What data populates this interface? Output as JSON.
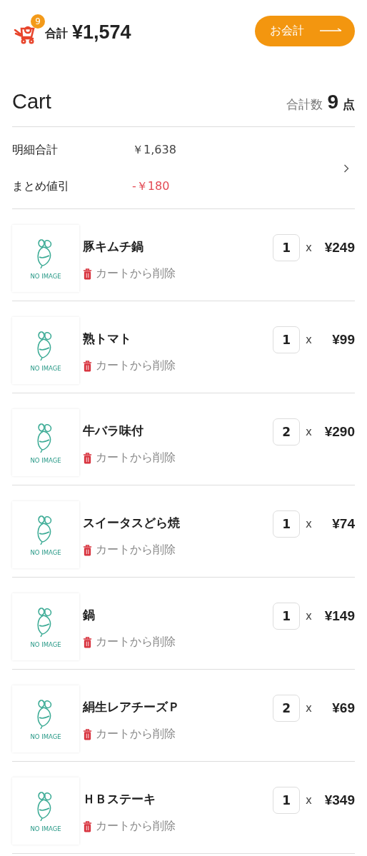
{
  "header": {
    "cart_count": "9",
    "total_label": "合計",
    "total": "¥1,574",
    "checkout_button": "お会計"
  },
  "cart": {
    "title": "Cart",
    "count_label": "合計数",
    "count": "9",
    "count_unit": "点"
  },
  "summary": [
    {
      "label": "明細合計",
      "value": "￥1,638",
      "kind": "normal"
    },
    {
      "label": "まとめ値引",
      "value": "-￥180",
      "kind": "discount"
    }
  ],
  "items": [
    {
      "name": "豚キムチ鍋",
      "image_label": "NO IMAGE",
      "remove": "カートから削除",
      "quantity": "1",
      "times": "x",
      "price": "¥249"
    },
    {
      "name": "熟トマト",
      "image_label": "NO IMAGE",
      "remove": "カートから削除",
      "quantity": "1",
      "times": "x",
      "price": "¥99"
    },
    {
      "name": "牛バラ味付",
      "image_label": "NO IMAGE",
      "remove": "カートから削除",
      "quantity": "2",
      "times": "x",
      "price": "¥290"
    },
    {
      "name": "スイータスどら焼",
      "image_label": "NO IMAGE",
      "remove": "カートから削除",
      "quantity": "1",
      "times": "x",
      "price": "¥74"
    },
    {
      "name": "鍋",
      "image_label": "NO IMAGE",
      "remove": "カートから削除",
      "quantity": "1",
      "times": "x",
      "price": "¥149"
    },
    {
      "name": "絹生レアチーズＰ",
      "image_label": "NO IMAGE",
      "remove": "カートから削除",
      "quantity": "2",
      "times": "x",
      "price": "¥69"
    },
    {
      "name": "ＨＢステーキ",
      "image_label": "NO IMAGE",
      "remove": "カートから削除",
      "quantity": "1",
      "times": "x",
      "price": "¥349"
    }
  ]
}
